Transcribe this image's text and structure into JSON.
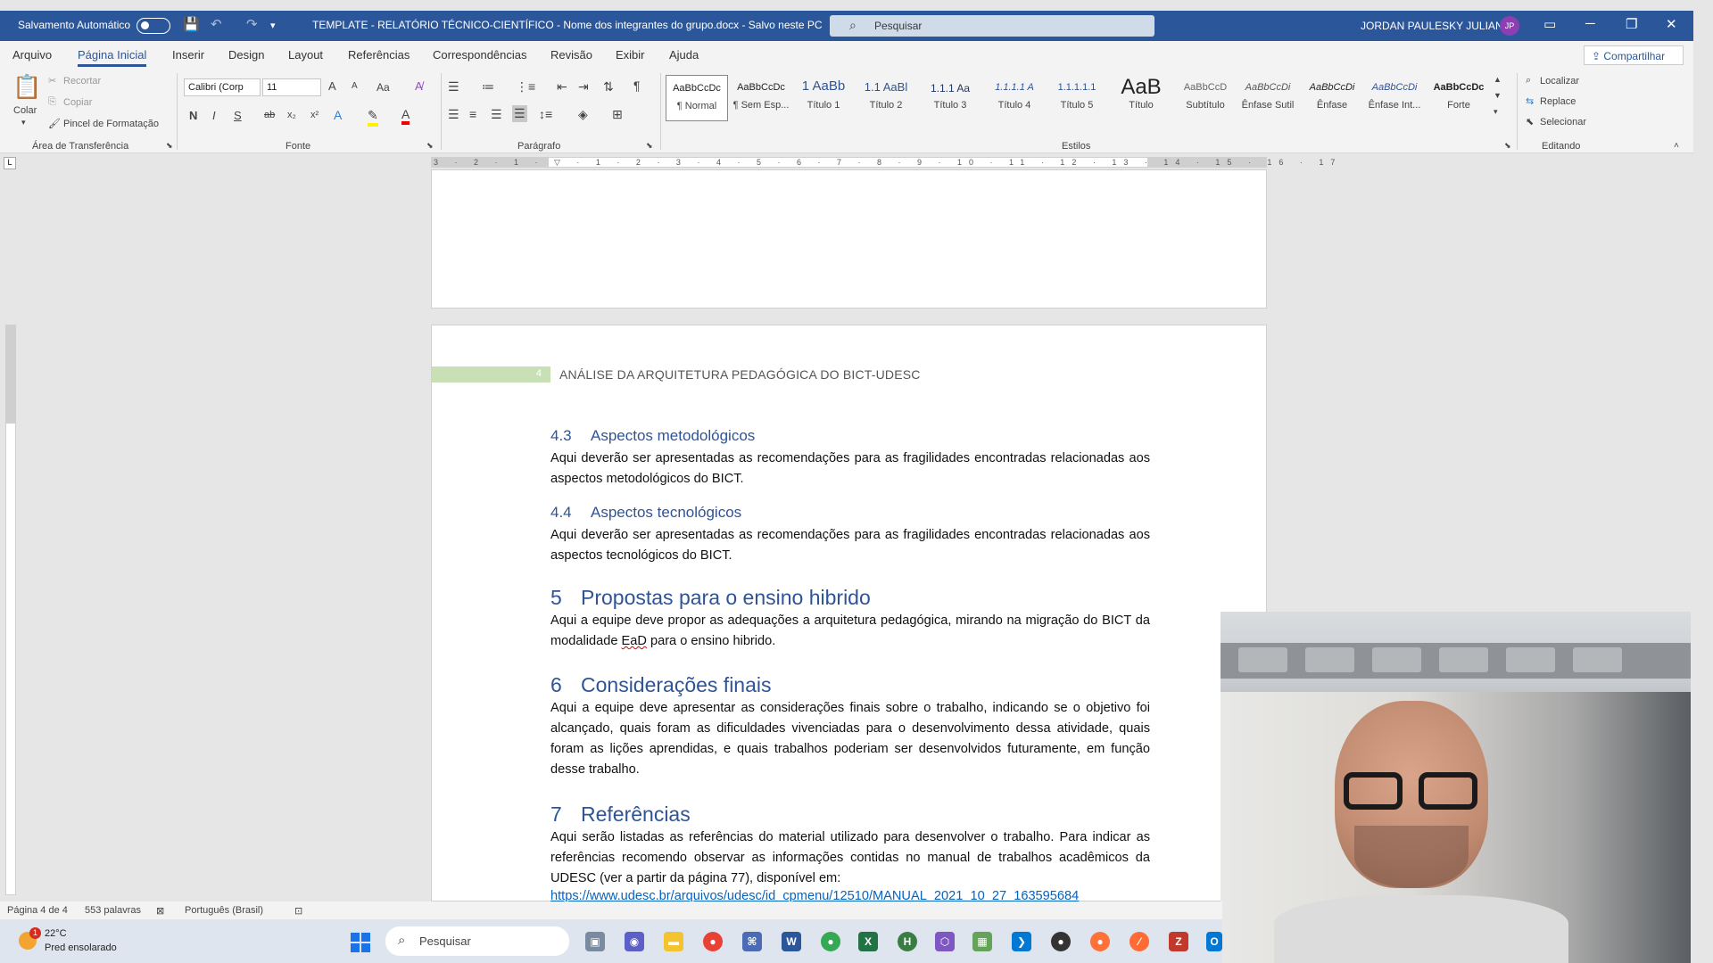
{
  "titlebar": {
    "autosave_label": "Salvamento Automático",
    "doc_title": "TEMPLATE - RELATÓRIO TÉCNICO-CIENTÍFICO - Nome dos integrantes do grupo.docx  -  Salvo neste PC",
    "search_placeholder": "Pesquisar",
    "user_name": "JORDAN PAULESKY JULIANI",
    "user_initials": "JP"
  },
  "menu": {
    "items": [
      "Arquivo",
      "Página Inicial",
      "Inserir",
      "Design",
      "Layout",
      "Referências",
      "Correspondências",
      "Revisão",
      "Exibir",
      "Ajuda"
    ],
    "active": "Página Inicial",
    "share_label": "Compartilhar"
  },
  "ribbon": {
    "clipboard": {
      "paste": "Colar",
      "cut": "Recortar",
      "copy": "Copiar",
      "format_painter": "Pincel de Formatação",
      "group_label": "Área de Transferência"
    },
    "font": {
      "family": "Calibri (Corp",
      "size": "11",
      "bold": "N",
      "italic": "I",
      "underline": "S",
      "strike": "ab",
      "sub": "x₂",
      "sup": "x²",
      "change_case": "Aa",
      "grow": "A",
      "shrink": "A",
      "group_label": "Fonte"
    },
    "paragraph": {
      "pilcrow": "¶",
      "group_label": "Parágrafo"
    },
    "styles": {
      "items": [
        {
          "sample": "AaBbCcDc",
          "name": "¶ Normal"
        },
        {
          "sample": "AaBbCcDc",
          "name": "¶ Sem Esp..."
        },
        {
          "sample": "1  AaBb",
          "name": "Título 1"
        },
        {
          "sample": "1.1  AaBl",
          "name": "Título 2"
        },
        {
          "sample": "1.1.1  Aa",
          "name": "Título 3"
        },
        {
          "sample": "1.1.1.1  A",
          "name": "Título 4"
        },
        {
          "sample": "1.1.1.1.1",
          "name": "Título 5"
        },
        {
          "sample": "AaB",
          "name": "Título"
        },
        {
          "sample": "AaBbCcD",
          "name": "Subtítulo"
        },
        {
          "sample": "AaBbCcDi",
          "name": "Ênfase Sutil"
        },
        {
          "sample": "AaBbCcDi",
          "name": "Ênfase"
        },
        {
          "sample": "AaBbCcDi",
          "name": "Ênfase Int..."
        },
        {
          "sample": "AaBbCcDc",
          "name": "Forte"
        }
      ],
      "group_label": "Estilos"
    },
    "editing": {
      "find": "Localizar",
      "replace": "Replace",
      "select": "Selecionar",
      "group_label": "Editando"
    }
  },
  "ruler": {
    "numbers": "3 · 2 · 1 · ▽ · 1 · 2 · 3 · 4 · 5 · 6 · 7 · 8 · 9 · 10 · 11 · 12 · 13 · 14 · 15 · 16 · 17",
    "corner": "L"
  },
  "document": {
    "header_number": "4",
    "header_text": "ANÁLISE DA ARQUITETURA PEDAGÓGICA DO BICT-UDESC",
    "sec_4_3": {
      "num": "4.3",
      "title": "Aspectos metodológicos",
      "body": "Aqui deverão ser apresentadas as recomendações para as fragilidades encontradas relacionadas aos aspectos metodológicos do BICT."
    },
    "sec_4_4": {
      "num": "4.4",
      "title": "Aspectos tecnológicos",
      "body": "Aqui deverão ser apresentadas as recomendações para as fragilidades encontradas relacionadas aos aspectos tecnológicos do BICT."
    },
    "sec_5": {
      "num": "5",
      "title": "Propostas para o ensino hibrido",
      "body_a": "Aqui a equipe deve propor as adequações a arquitetura pedagógica, mirando na migração do BICT da modalidade ",
      "body_ead": "EaD",
      "body_b": " para o ensino hibrido."
    },
    "sec_6": {
      "num": "6",
      "title": "Considerações finais",
      "body": "Aqui a equipe deve apresentar as considerações finais sobre o trabalho, indicando se o objetivo foi alcançado, quais foram as dificuldades vivenciadas para o desenvolvimento dessa atividade, quais foram as lições aprendidas, e quais trabalhos poderiam ser desenvolvidos futuramente, em função desse trabalho."
    },
    "sec_7": {
      "num": "7",
      "title": "Referências",
      "body": "Aqui serão listadas as referências do material utilizado para desenvolver o trabalho. Para indicar as referências recomendo observar as informações contidas no manual de trabalhos acadêmicos da UDESC (ver a partir da página 77), disponível em:",
      "link": "https://www.udesc.br/arquivos/udesc/id_cpmenu/12510/MANUAL_2021_10_27_163595684"
    }
  },
  "statusbar": {
    "page": "Página 4 de 4",
    "words": "553 palavras",
    "language": "Português (Brasil)"
  },
  "taskbar": {
    "weather_badge": "1",
    "temperature": "22°C",
    "weather": "Pred ensolarado",
    "search_label": "Pesquisar"
  }
}
